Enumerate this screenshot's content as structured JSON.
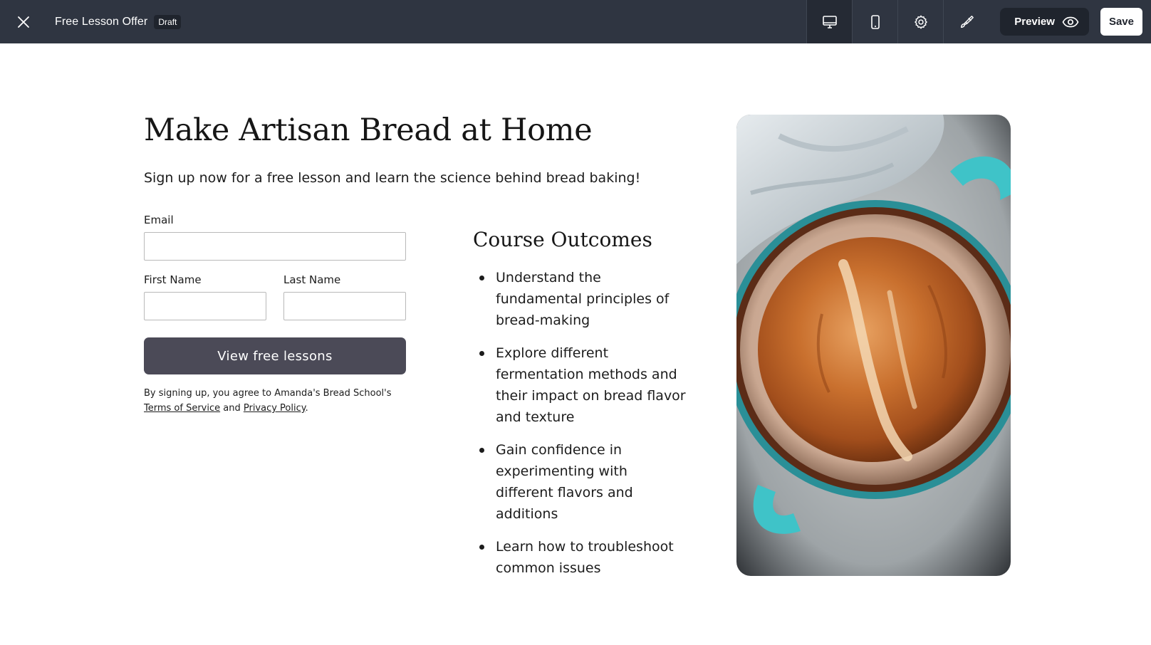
{
  "topbar": {
    "title": "Free Lesson Offer",
    "status_badge": "Draft",
    "tools": [
      {
        "name": "desktop-view",
        "icon": "monitor-icon"
      },
      {
        "name": "mobile-view",
        "icon": "phone-icon"
      },
      {
        "name": "settings",
        "icon": "gear-icon"
      },
      {
        "name": "design",
        "icon": "paintbrush-icon"
      }
    ],
    "preview_label": "Preview",
    "save_label": "Save",
    "background_color": "#2f3541"
  },
  "page": {
    "headline": "Make Artisan Bread at Home",
    "subheadline": "Sign up now for a free lesson and learn the science behind bread baking!",
    "form": {
      "email_label": "Email",
      "email_value": "",
      "first_name_label": "First Name",
      "first_name_value": "",
      "last_name_label": "Last Name",
      "last_name_value": "",
      "submit_label": "View free lessons",
      "legal_prefix": "By signing up, you agree to Amanda's Bread School's ",
      "terms_link": "Terms of Service",
      "legal_and": " and ",
      "privacy_link": "Privacy Policy",
      "legal_suffix": "."
    },
    "outcomes": {
      "title": "Course Outcomes",
      "items": [
        "Understand the fundamental principles of bread-making",
        "Explore different fermentation methods and their impact on bread flavor and texture",
        "Gain confidence in experimenting with different flavors and additions",
        "Learn how to troubleshoot common issues"
      ]
    },
    "button_color": "#4b4a57",
    "image_subject": "bread-loaf-in-teal-dutch-oven"
  }
}
